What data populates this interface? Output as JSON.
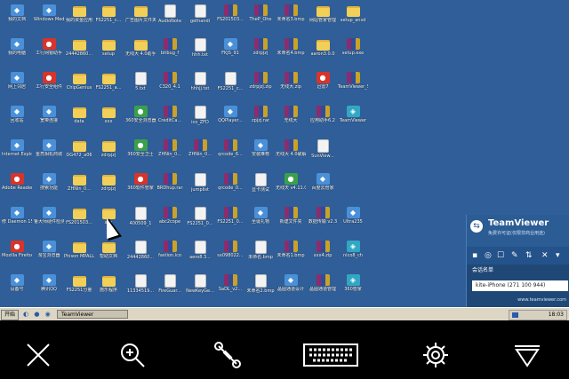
{
  "desktop": {
    "icons": [
      {
        "label": "我的文档",
        "type": "exe"
      },
      {
        "label": "Windows Medi...",
        "type": "exe"
      },
      {
        "label": "我的资金应用",
        "type": "folder"
      },
      {
        "label": "FS2251_c...",
        "type": "folder"
      },
      {
        "label": "广告图片文件夹",
        "type": "folder"
      },
      {
        "label": "AudioNote",
        "type": "file"
      },
      {
        "label": "gethandi",
        "type": "file"
      },
      {
        "label": "FS201503...",
        "type": "rar"
      },
      {
        "label": "TheP_Ohe",
        "type": "rar"
      },
      {
        "label": "未命名3.bmp",
        "type": "rar"
      },
      {
        "label": "网站管家管理",
        "type": "folder"
      },
      {
        "label": "setup_ansd",
        "type": "folder"
      },
      {
        "label": "我的电脑",
        "type": "exe"
      },
      {
        "label": "工行网银助手",
        "type": "red"
      },
      {
        "label": "24442860...",
        "type": "folder"
      },
      {
        "label": "setup",
        "type": "folder"
      },
      {
        "label": "无线大 4.0助手",
        "type": "folder"
      },
      {
        "label": "bitbug_f",
        "type": "rar"
      },
      {
        "label": "hhh.txt",
        "type": "file"
      },
      {
        "label": "FKJS_91",
        "type": "exe"
      },
      {
        "label": "zdrpjzj",
        "type": "rar"
      },
      {
        "label": "未命名4.bmp",
        "type": "rar"
      },
      {
        "label": "aaron3.0.0",
        "type": "folder"
      },
      {
        "label": "setup.exe",
        "type": "rar"
      },
      {
        "label": "网上邻居",
        "type": "exe"
      },
      {
        "label": "工行安全组件",
        "type": "red"
      },
      {
        "label": "ChipGenius",
        "type": "folder"
      },
      {
        "label": "FS2251_a...",
        "type": "folder"
      },
      {
        "label": "5.txt",
        "type": "file"
      },
      {
        "label": "C320_4.1",
        "type": "rar"
      },
      {
        "label": "hhhjj.txt",
        "type": "file"
      },
      {
        "label": "FS2251_c...",
        "type": "file"
      },
      {
        "label": "zdrpjzj.zip",
        "type": "rar"
      },
      {
        "label": "无线大.zip",
        "type": "rar"
      },
      {
        "label": "迅雷7",
        "type": "red"
      },
      {
        "label": "TeamViewer_Setup_zhcn.exe",
        "type": "rar"
      },
      {
        "label": "回收站",
        "type": "exe"
      },
      {
        "label": "宽带连接",
        "type": "exe"
      },
      {
        "label": "data",
        "type": "folder"
      },
      {
        "label": "xxx",
        "type": "folder"
      },
      {
        "label": "360安全浏览器",
        "type": "green"
      },
      {
        "label": "CreditCa...",
        "type": "rar"
      },
      {
        "label": "ico_ZFD",
        "type": "file"
      },
      {
        "label": "QQPlayer...",
        "type": "exe"
      },
      {
        "label": "zpjzj.rar",
        "type": "rar"
      },
      {
        "label": "无线大",
        "type": "rar"
      },
      {
        "label": "应用助手6.2",
        "type": "rar"
      },
      {
        "label": "TeamViewer",
        "type": "cyan"
      },
      {
        "label": "Internet Explorer",
        "type": "exe"
      },
      {
        "label": "金亮相机商城",
        "type": "exe"
      },
      {
        "label": "DG472_a06",
        "type": "folder"
      },
      {
        "label": "zdrpjzj",
        "type": "folder"
      },
      {
        "label": "360安全卫士",
        "type": "green"
      },
      {
        "label": "ZHNin_0...",
        "type": "rar"
      },
      {
        "label": "ZHNin_0...",
        "type": "rar"
      },
      {
        "label": "qrcode_6...",
        "type": "rar"
      },
      {
        "label": "安装推荐",
        "type": "exe"
      },
      {
        "label": "无线大 4.0破解版",
        "type": "rar"
      },
      {
        "label": "SunView...",
        "type": "file"
      },
      {
        "label": "Adobe Reader XI",
        "type": "red"
      },
      {
        "label": "搜索功能",
        "type": "exe"
      },
      {
        "label": "ZHNin_0...",
        "type": "folder"
      },
      {
        "label": "zdrpjzj",
        "type": "folder"
      },
      {
        "label": "360软件管家",
        "type": "red"
      },
      {
        "label": "BRDhup.rar",
        "type": "rar"
      },
      {
        "label": "jumplist",
        "type": "file"
      },
      {
        "label": "qrcode_0...",
        "type": "rar"
      },
      {
        "label": "显卡测试",
        "type": "file"
      },
      {
        "label": "无线天 v4.11.0",
        "type": "green"
      },
      {
        "label": "百度云管家",
        "type": "exe"
      },
      {
        "label": "修 Daemon 1510 series",
        "type": "exe"
      },
      {
        "label": "鲁大师硬件检测",
        "type": "exe"
      },
      {
        "label": "FS201503...",
        "type": "folder"
      },
      {
        "label": "xxx",
        "type": "folder"
      },
      {
        "label": "400509_1",
        "type": "file"
      },
      {
        "label": "abc2cope",
        "type": "rar"
      },
      {
        "label": "FS2251_0...",
        "type": "file"
      },
      {
        "label": "FS2251_0...",
        "type": "rar"
      },
      {
        "label": "圣诞礼物",
        "type": "exe"
      },
      {
        "label": "新建文件夹",
        "type": "rar"
      },
      {
        "label": "数据传输 v2.3",
        "type": "rar"
      },
      {
        "label": "Ultra235",
        "type": "exe"
      },
      {
        "label": "Mozilla Firefox",
        "type": "red"
      },
      {
        "label": "淘宝浏览器",
        "type": "exe"
      },
      {
        "label": "Phison MPALL...",
        "type": "folder"
      },
      {
        "label": "帮助文档",
        "type": "folder"
      },
      {
        "label": "24442860...",
        "type": "file"
      },
      {
        "label": "fastion.ico",
        "type": "rar"
      },
      {
        "label": "aero8.3...",
        "type": "file"
      },
      {
        "label": "sx098022...",
        "type": "rar"
      },
      {
        "label": "未命名.bmp",
        "type": "file"
      },
      {
        "label": "未命名1.bmp",
        "type": "rar"
      },
      {
        "label": "xxx4.zip",
        "type": "rar"
      },
      {
        "label": "nico8_ch",
        "type": "cyan"
      },
      {
        "label": "设备号",
        "type": "exe"
      },
      {
        "label": "腾讯QQ",
        "type": "exe"
      },
      {
        "label": "FS2251分量",
        "type": "folder"
      },
      {
        "label": "施乐程序",
        "type": "folder"
      },
      {
        "label": "11334519...",
        "type": "file"
      },
      {
        "label": "FireGuar...",
        "type": "file"
      },
      {
        "label": "NewKeyGe...",
        "type": "file"
      },
      {
        "label": "SaDL_v2...",
        "type": "rar"
      },
      {
        "label": "未命名2.bmp",
        "type": "file"
      },
      {
        "label": "晶图通道设计",
        "type": "exe"
      },
      {
        "label": "晶图通道管理",
        "type": "rar"
      },
      {
        "label": "360管家",
        "type": "cyan"
      }
    ]
  },
  "taskbar": {
    "start_label": "开始",
    "quicklaunch_glyphs": "◐ ● ◉",
    "window_button": "TeamViewer",
    "clock": "18:03"
  },
  "teamviewer": {
    "title": "TeamViewer",
    "subtitle": "免费许可证(仅限非商业用途)",
    "partner_header": "会话名单",
    "partner_row": "kite-iPhone (271 100 944)",
    "website": "www.teamviewer.com"
  },
  "colors": {
    "desktop": "#2f5e98",
    "teamviewer_panel": "#1f4877",
    "toolbar": "#000000"
  },
  "toolbar": {
    "icons": [
      "close-icon",
      "zoom-in-icon",
      "wrench-icon",
      "keyboard-icon",
      "gear-icon",
      "collapse-icon"
    ]
  }
}
